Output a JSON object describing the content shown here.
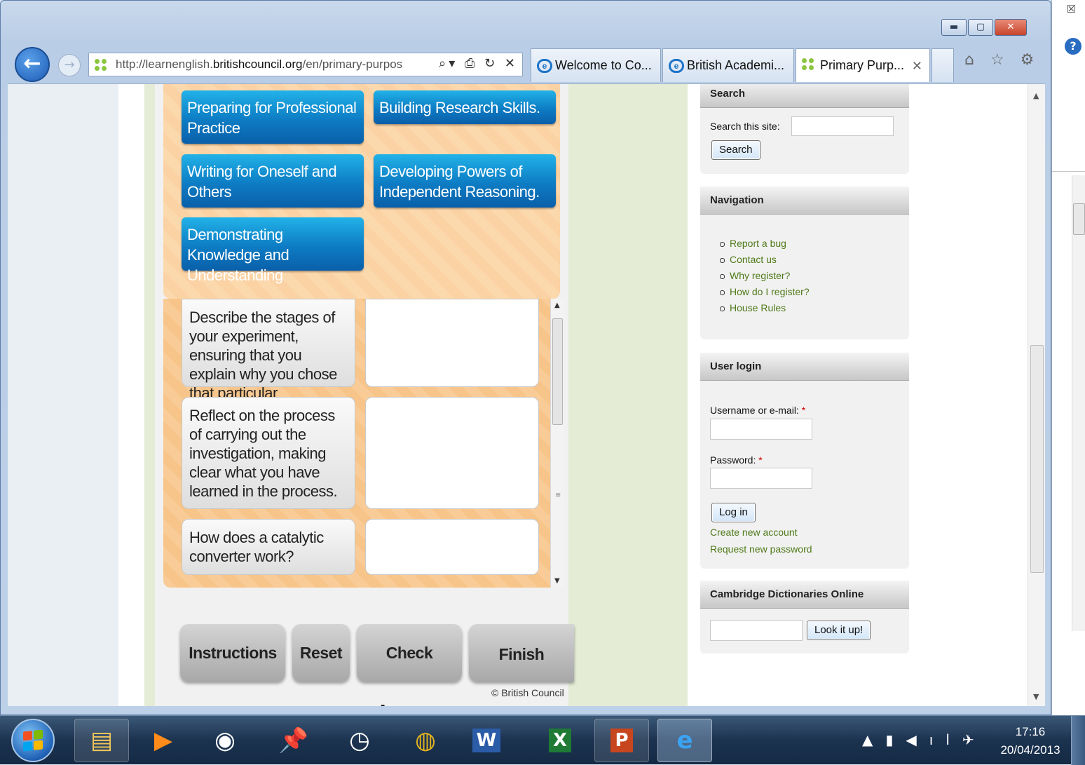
{
  "browser": {
    "url_prefix": "http://learnenglish.",
    "url_domain": "britishcouncil.org",
    "url_path": "/en/primary-purpos",
    "address_tools": "⌕▾ ⎙ ↻ ✕",
    "tabs": [
      {
        "label": "Welcome to Co..."
      },
      {
        "label": "British Academi..."
      },
      {
        "label": "Primary Purp...",
        "close": "✕"
      }
    ],
    "toolbar_icons": "⌂ ☆ ⚙",
    "window_controls": {
      "minimize": "▬",
      "maximize": "▢",
      "close": "✕"
    },
    "side_close": "☒",
    "help": "?"
  },
  "activity": {
    "purpose_buttons": [
      "Preparing for Professional Practice",
      "Building Research Skills.",
      "Writing for Oneself and Others",
      "Developing Powers of Independent Reasoning.",
      "Demonstrating Knowledge and Understanding"
    ],
    "questions": [
      "Describe the stages of your experiment, ensuring that you explain why you chose that particular precedure.",
      "Reflect on the process of carrying out the investigation, making clear what you have learned in the process.",
      "How does a catalytic converter work?"
    ],
    "controls": {
      "instructions": "Instructions",
      "reset": "Reset",
      "check_answers": "Check Answers",
      "finish": "Finish"
    },
    "copyright": "© British Council"
  },
  "sidebar": {
    "search": {
      "title": "Search",
      "label": "Search this site:",
      "button": "Search",
      "value": ""
    },
    "navigation": {
      "title": "Navigation",
      "items": [
        "Report a bug",
        "Contact us",
        "Why register?",
        "How do I register?",
        "House Rules"
      ]
    },
    "login": {
      "title": "User login",
      "username_label": "Username or e-mail:",
      "password_label": "Password:",
      "required_mark": "*",
      "button": "Log in",
      "create_account": "Create new account",
      "request_password": "Request new password"
    },
    "dictionary": {
      "title": "Cambridge Dictionaries Online",
      "button": "Look it up!",
      "value": ""
    }
  },
  "taskbar": {
    "apps": [
      "Windows Explorer",
      "Windows Media Player",
      "User",
      "Notes",
      "Clock",
      "Google Chrome",
      "Microsoft Word",
      "Microsoft Excel",
      "Microsoft PowerPoint",
      "Internet Explorer"
    ],
    "time": "17:16",
    "date": "20/04/2013"
  },
  "colors": {
    "accent_blue": "#0d7cc4",
    "link_green": "#4f7a19",
    "activity_orange": "#f9cc97"
  }
}
